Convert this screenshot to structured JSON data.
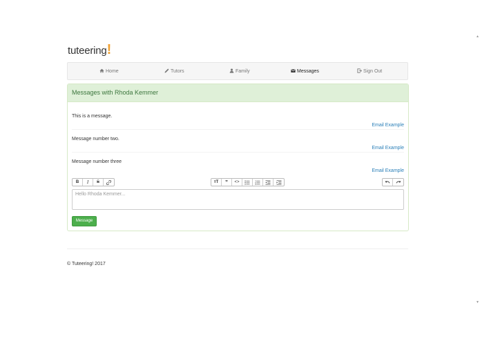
{
  "brand": {
    "name": "tuteering",
    "mark": "!"
  },
  "nav": {
    "items": [
      {
        "label": "Home",
        "icon": "home-icon",
        "active": false
      },
      {
        "label": "Tutors",
        "icon": "pencil-icon",
        "active": false
      },
      {
        "label": "Family",
        "icon": "user-icon",
        "active": false
      },
      {
        "label": "Messages",
        "icon": "envelope-icon",
        "active": true
      },
      {
        "label": "Sign Out",
        "icon": "sign-out-icon",
        "active": false
      }
    ]
  },
  "panel": {
    "title": "Messages with Rhoda Kemmer",
    "messages": [
      {
        "text": "This is a message.",
        "sender": "Email Example"
      },
      {
        "text": "Message number two.",
        "sender": "Email Example"
      },
      {
        "text": "Message number three",
        "sender": "Email Example"
      }
    ]
  },
  "toolbar": {
    "groups": [
      [
        "bold-icon",
        "italic-icon",
        "strikethrough-icon",
        "link-icon"
      ],
      [
        "heading-icon",
        "quote-icon",
        "code-icon",
        "bullet-list-icon",
        "numbered-list-icon",
        "outdent-icon",
        "indent-icon"
      ],
      [
        "undo-icon",
        "redo-icon"
      ]
    ]
  },
  "composer": {
    "placeholder": "Hello Rhoda Kemmer...",
    "send_label": "Message"
  },
  "footer": {
    "text": "© Tuteering! 2017"
  },
  "colors": {
    "accent": "#4cae4c",
    "heading_bg": "#dff0d8",
    "link": "#2a7fb8",
    "brand_mark": "#f0a030"
  }
}
